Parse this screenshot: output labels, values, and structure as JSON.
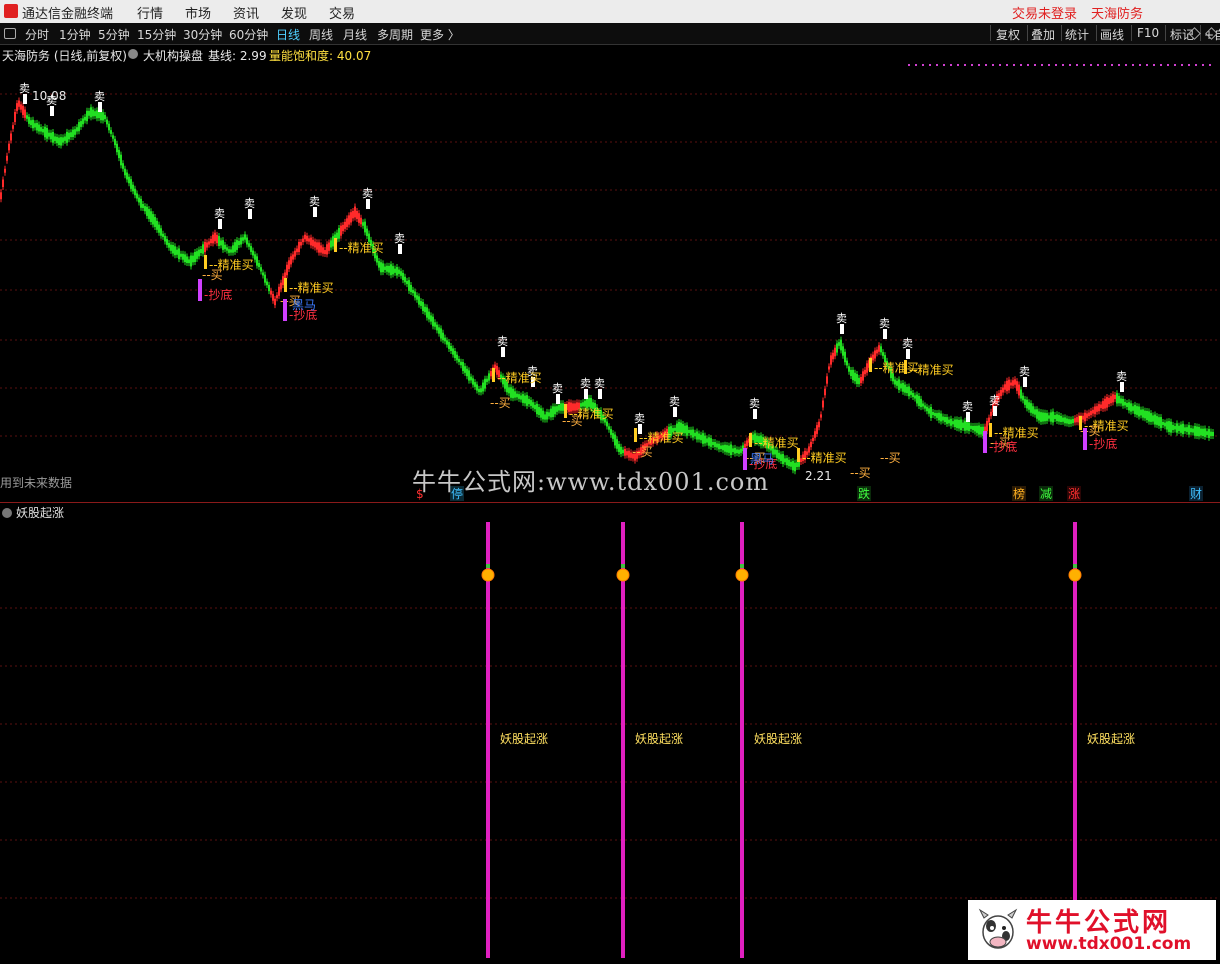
{
  "app": {
    "title": "通达信金融终端"
  },
  "menu": {
    "items": [
      "行情",
      "市场",
      "资讯",
      "发现",
      "交易"
    ],
    "login": "交易未登录",
    "account": "天海防务"
  },
  "toolbar": {
    "periods": [
      "分时",
      "1分钟",
      "5分钟",
      "15分钟",
      "30分钟",
      "60分钟",
      "日线",
      "周线",
      "月线",
      "多周期",
      "更多 〉"
    ],
    "active_period": "日线",
    "right_buttons": [
      "复权",
      "叠加",
      "统计",
      "画线",
      "F10",
      "标记",
      "+自"
    ]
  },
  "info": {
    "stock": "天海防务 (日线,前复权)",
    "indicator": "大机构操盘",
    "baseline_label": "基线: 2.99",
    "saturation_label": "量能饱和度: 40.07"
  },
  "chart": {
    "high_label": "10.08",
    "low_label": "2.21",
    "future_data_note": "用到未来数据",
    "signals": [
      "卖",
      "买",
      "精准买",
      "抄底",
      "黑马"
    ],
    "bottom_markers": [
      "$",
      "停",
      "跌",
      "榜",
      "减",
      "涨",
      "财"
    ]
  },
  "sub_chart": {
    "title": "妖股起涨",
    "signal_label": "妖股起涨",
    "signal_count": 4,
    "colors": {
      "line": "#e020c0",
      "label": "#ffe060"
    }
  },
  "watermark": {
    "text": "牛牛公式网:www.tdx001.com"
  },
  "brand": {
    "title": "牛牛公式网",
    "url": "www.tdx001.com"
  },
  "colors": {
    "up": "#ff2a2a",
    "down": "#22e022",
    "buy": "#ffcc22",
    "sell": "#ffffff",
    "grid": "#5a1010"
  }
}
